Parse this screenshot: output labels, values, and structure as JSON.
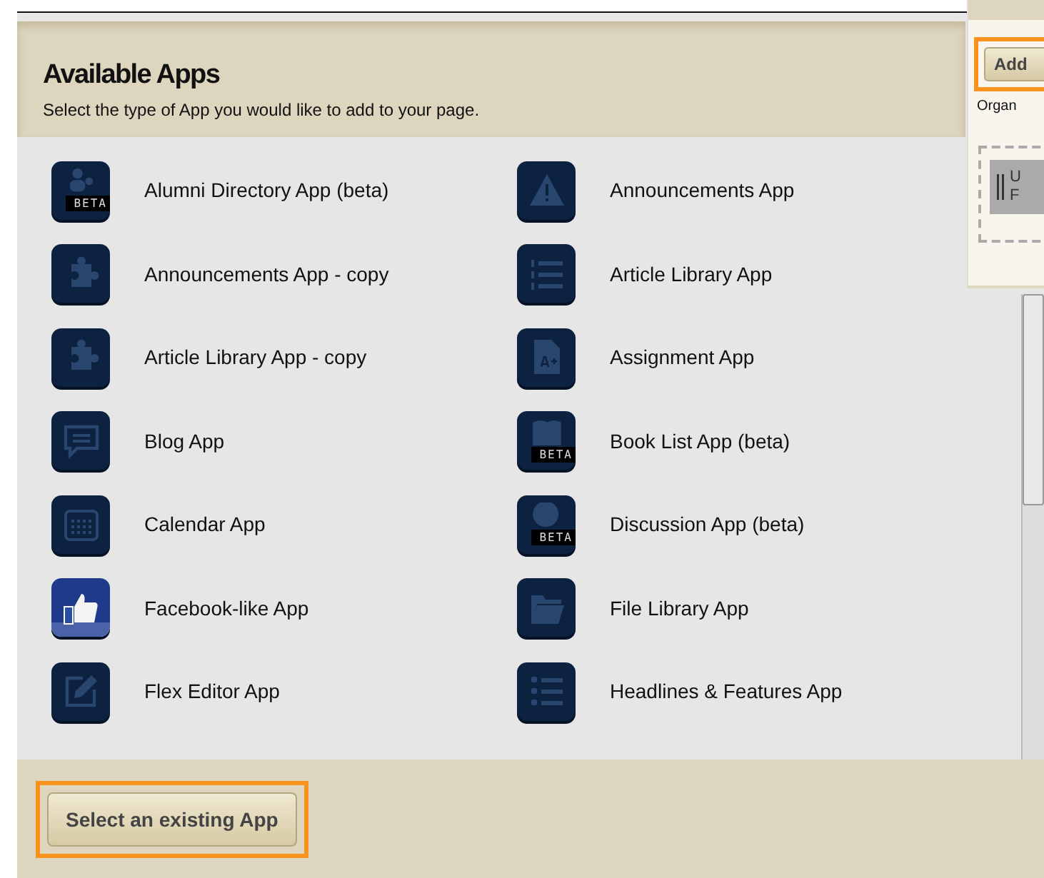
{
  "dialog": {
    "title": "Available Apps",
    "subtitle": "Select the type of App you would like to add to your page.",
    "apps": [
      {
        "label": "Alumni Directory App (beta)",
        "kind": "people",
        "badge": "BETA"
      },
      {
        "label": "Announcements App",
        "kind": "warning"
      },
      {
        "label": "Announcements App - copy",
        "kind": "puzzle"
      },
      {
        "label": "Article Library App",
        "kind": "numbered"
      },
      {
        "label": "Article Library App - copy",
        "kind": "puzzle"
      },
      {
        "label": "Assignment App",
        "kind": "grade"
      },
      {
        "label": "Blog App",
        "kind": "chat"
      },
      {
        "label": "Book List App (beta)",
        "kind": "book",
        "badge": "BETA"
      },
      {
        "label": "Calendar App",
        "kind": "calendar"
      },
      {
        "label": "Discussion App (beta)",
        "kind": "discussion",
        "badge": "BETA"
      },
      {
        "label": "Facebook-like App",
        "kind": "thumb"
      },
      {
        "label": "File Library App",
        "kind": "folder"
      },
      {
        "label": "Flex Editor App",
        "kind": "pencil"
      },
      {
        "label": "Headlines & Features App",
        "kind": "bullets"
      }
    ],
    "footer_button": "Select an existing App"
  },
  "background_panel": {
    "button": "Add",
    "caption": "Organ",
    "block_letters": [
      "U",
      "F"
    ]
  }
}
